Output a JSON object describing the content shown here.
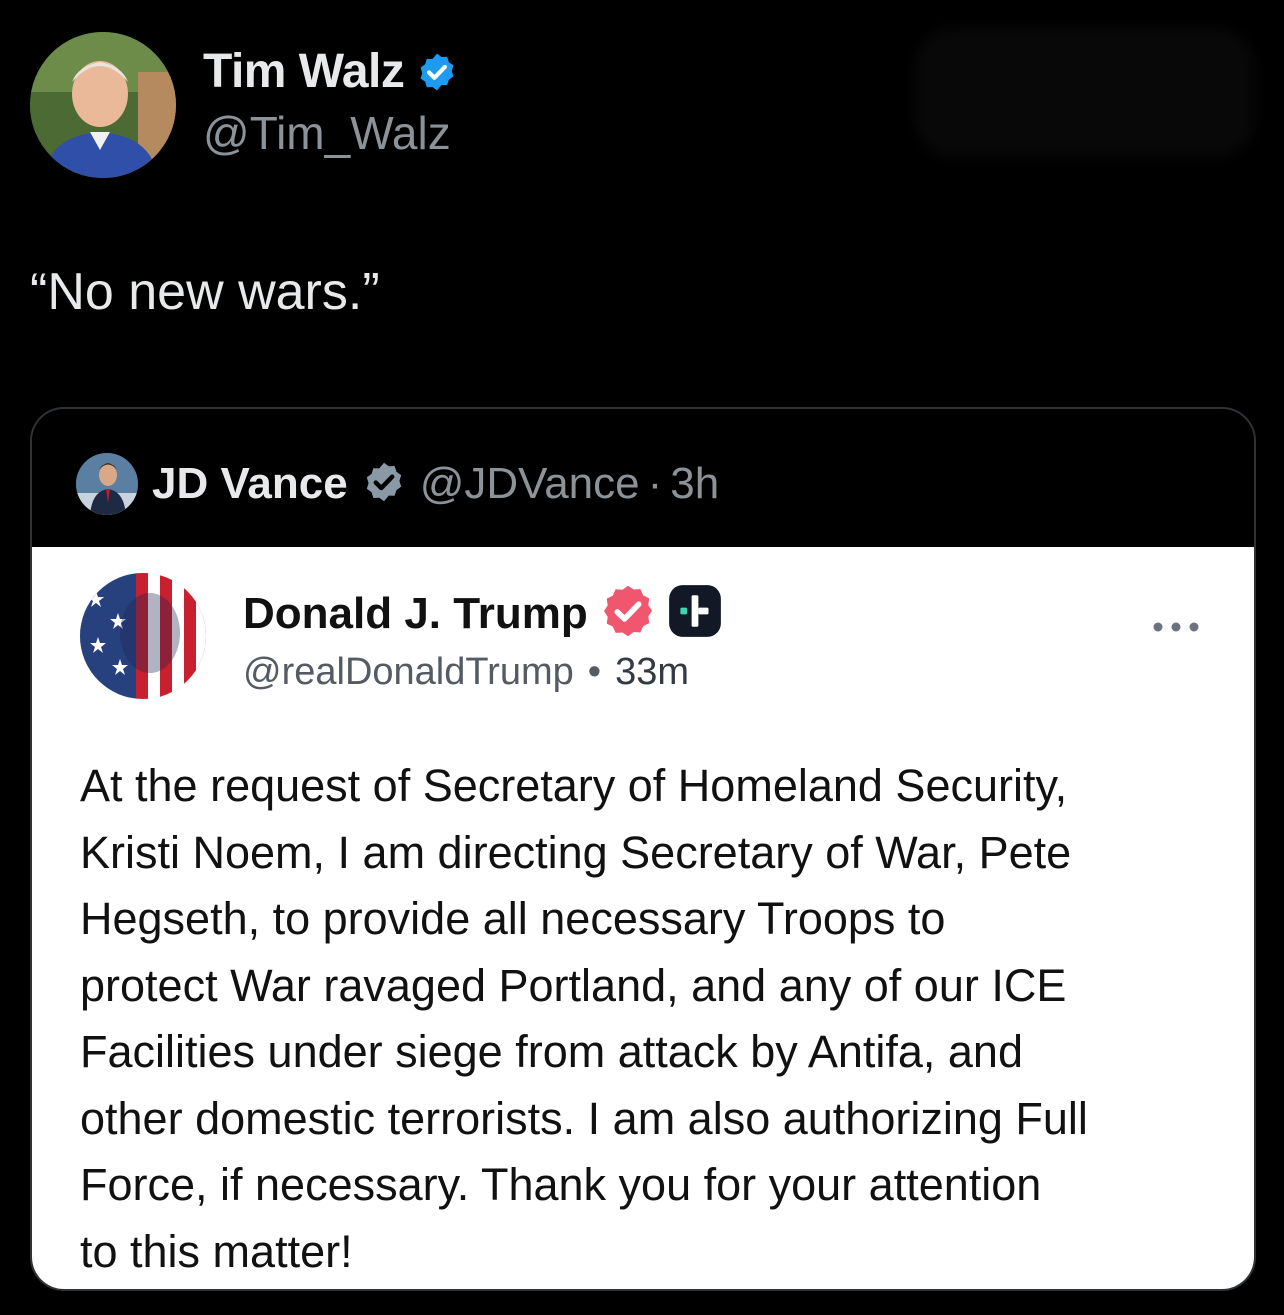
{
  "outer_tweet": {
    "author_name": "Tim Walz",
    "author_handle": "@Tim_Walz",
    "text": "“No new wars.”",
    "verified_color": "#1d9bf0"
  },
  "quoted_tweet": {
    "author_name": "JD Vance",
    "author_handle": "@JDVance",
    "separator": "·",
    "time": "3h",
    "verified_color": "#8b98a5"
  },
  "embedded_post": {
    "author_name": "Donald J. Trump",
    "author_handle": "@realDonaldTrump",
    "separator": "•",
    "time": "33m",
    "verified_color": "#f0566e",
    "body": "At the request of Secretary of Homeland Security,\nKristi Noem, I am directing Secretary of War, Pete\nHegseth, to provide all necessary Troops to\nprotect War ravaged Portland, and any of our ICE\nFacilities under siege from attack by Antifa, and\nother domestic terrorists. I am also authorizing Full\nForce, if necessary. Thank you for your attention\nto this matter!"
  },
  "icons": {
    "outer_verified": "verified-badge-icon",
    "quote_verified": "verified-badge-icon",
    "embed_verified": "verified-badge-icon",
    "embed_app_badge": "plus-badge-icon",
    "more": "more-options-icon"
  }
}
